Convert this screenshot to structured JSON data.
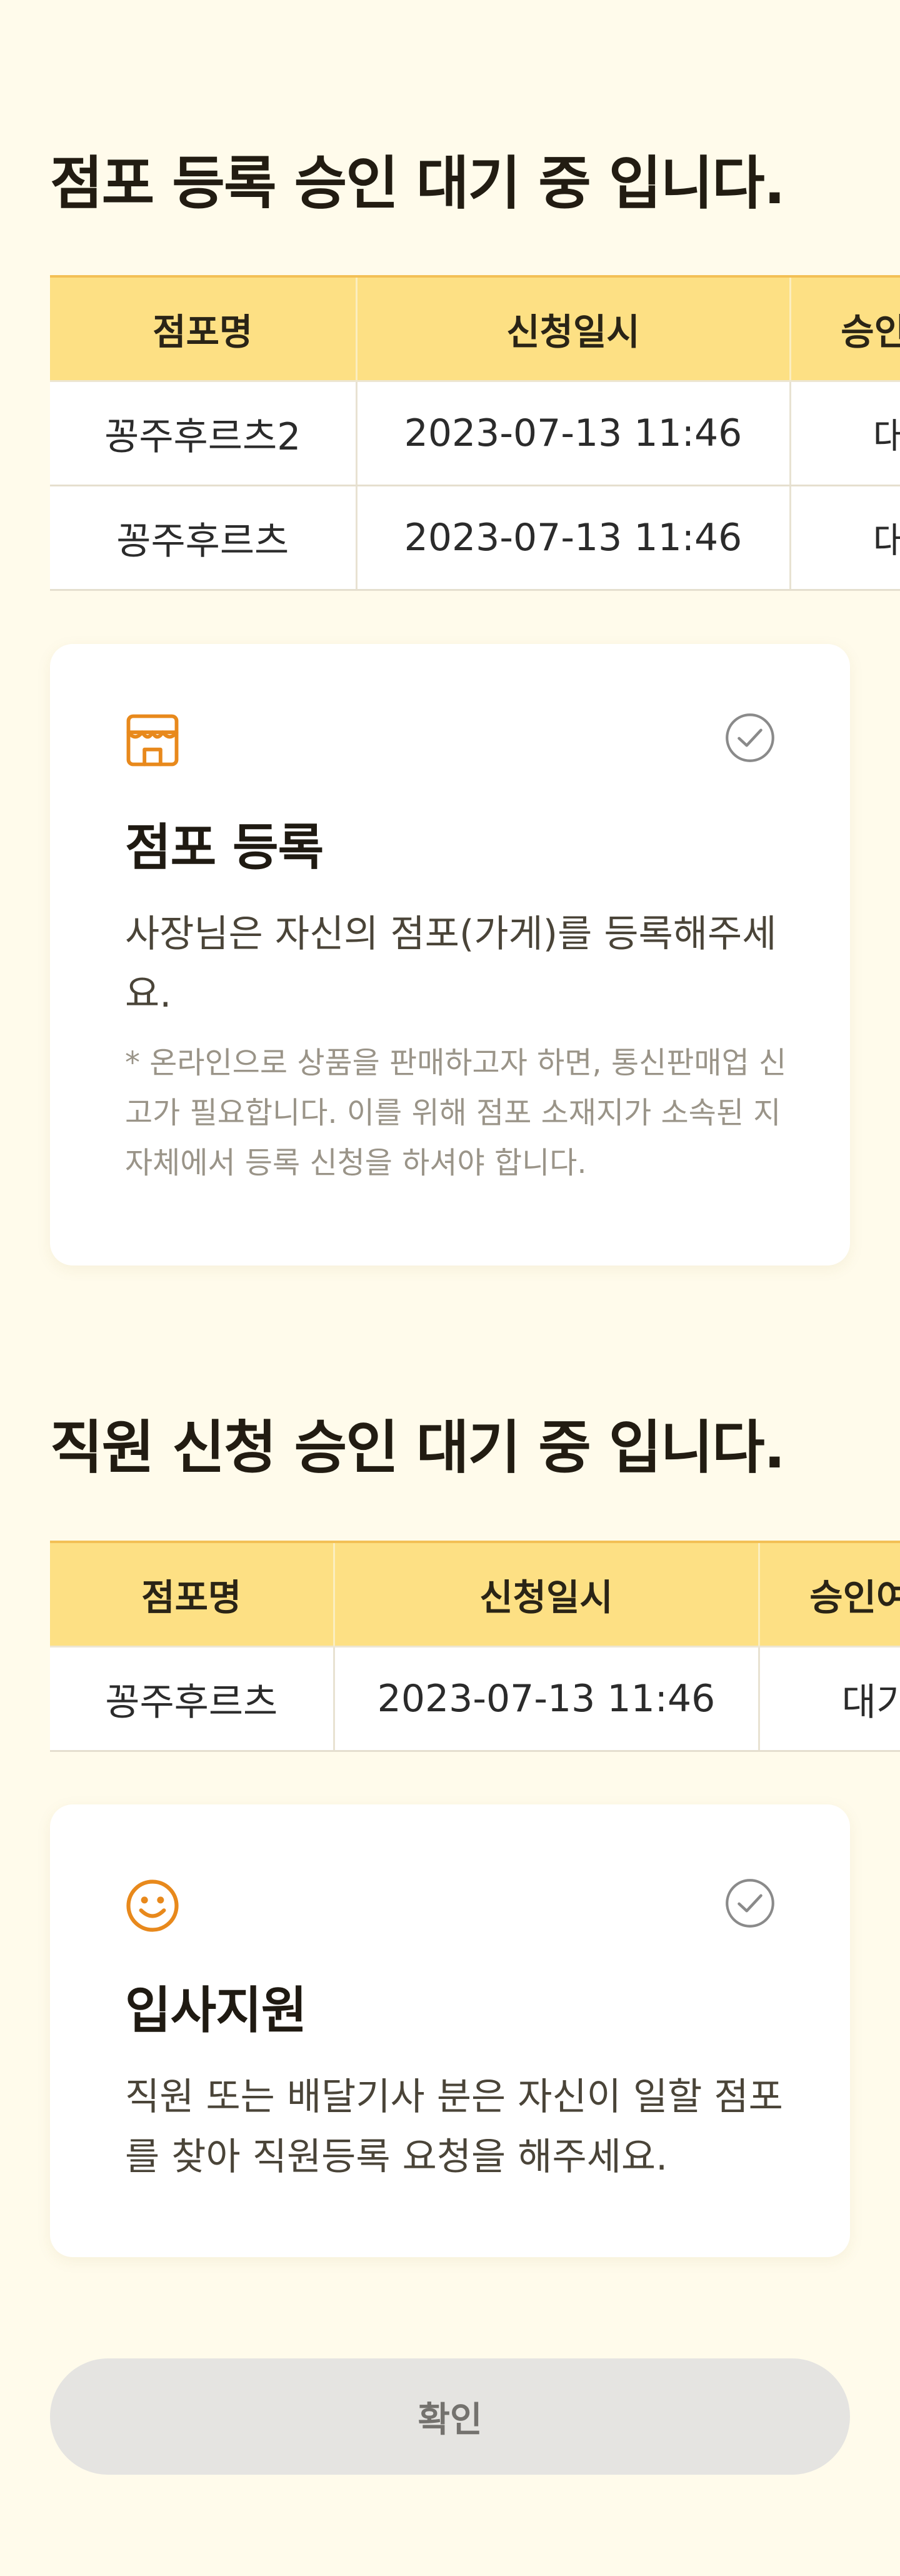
{
  "store_section": {
    "title": "점포 등록 승인 대기 중 입니다.",
    "table": {
      "headers": [
        "점포명",
        "신청일시",
        "승인여부"
      ],
      "rows": [
        [
          "꽁주후르츠2",
          "2023-07-13 11:46",
          "대기"
        ],
        [
          "꽁주후르츠",
          "2023-07-13 11:46",
          "대기"
        ]
      ]
    },
    "card": {
      "icon": "store-icon",
      "check_icon": "check-circle-icon",
      "title": "점포 등록",
      "description": "사장님은 자신의 점포(가게)를 등록해주세요.",
      "note": "* 온라인으로 상품을 판매하고자 하면, 통신판매업 신고가 필요합니다. 이를 위해 점포 소재지가 소속된 지자체에서 등록 신청을 하셔야 합니다."
    }
  },
  "employee_section": {
    "title": "직원 신청 승인 대기 중 입니다.",
    "table": {
      "headers": [
        "점포명",
        "신청일시",
        "승인여부"
      ],
      "rows": [
        [
          "꽁주후르츠",
          "2023-07-13 11:46",
          "대기"
        ]
      ]
    },
    "card": {
      "icon": "smile-icon",
      "check_icon": "check-circle-icon",
      "title": "입사지원",
      "description": "직원 또는 배달기사 분은 자신이 일할 점포를 찾아 직원등록 요청을 해주세요."
    }
  },
  "confirm_button": {
    "label": "확인"
  },
  "colors": {
    "background": "#fffbeb",
    "table_header": "#fde084",
    "accent_orange": "#e8891c",
    "check_gray": "#8a8a8a",
    "button_bg": "#e5e4e1"
  }
}
